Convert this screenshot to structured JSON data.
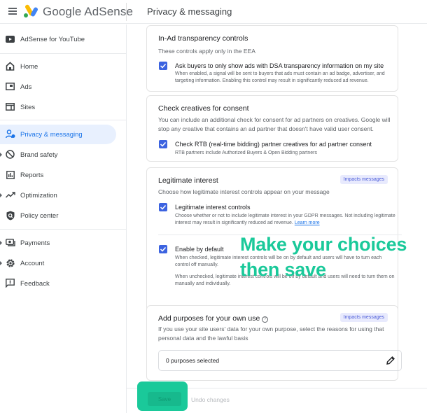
{
  "header": {
    "app_name": "Google AdSense",
    "page_title": "Privacy & messaging"
  },
  "sidebar": {
    "items": [
      {
        "label": "AdSense for YouTube",
        "icon": "youtube-icon"
      },
      {
        "label": "Home",
        "icon": "home-icon"
      },
      {
        "label": "Ads",
        "icon": "ads-icon"
      },
      {
        "label": "Sites",
        "icon": "sites-icon"
      },
      {
        "label": "Privacy & messaging",
        "icon": "privacy-icon",
        "active": true
      },
      {
        "label": "Brand safety",
        "icon": "block-icon",
        "expandable": true
      },
      {
        "label": "Reports",
        "icon": "reports-icon"
      },
      {
        "label": "Optimization",
        "icon": "trending-icon",
        "expandable": true
      },
      {
        "label": "Policy center",
        "icon": "policy-icon"
      },
      {
        "label": "Payments",
        "icon": "payments-icon",
        "expandable": true
      },
      {
        "label": "Account",
        "icon": "settings-icon",
        "expandable": true
      },
      {
        "label": "Feedback",
        "icon": "feedback-icon"
      }
    ]
  },
  "cards": {
    "transparency": {
      "title": "In-Ad transparency controls",
      "subtitle": "These controls apply only in the EEA",
      "option_title": "Ask buyers to only show ads with DSA transparency information on my site",
      "option_desc": "When enabled, a signal will be sent to buyers that ads must contain an ad badge, advertiser, and targeting information. Enabling this control may result in significantly reduced ad revenue.",
      "checked": true
    },
    "consent": {
      "title": "Check creatives for consent",
      "subtitle": "You can include an additional check for consent for ad partners on creatives. Google will stop any creative that contains an ad partner that doesn't have valid user consent.",
      "option_title": "Check RTB (real-time bidding) partner creatives for ad partner consent",
      "option_desc": "RTB partners include Authorized Buyers & Open Bidding partners",
      "checked": true
    },
    "legitimate": {
      "title": "Legitimate interest",
      "badge": "Impacts messages",
      "subtitle": "Choose how legitimate interest controls appear on your message",
      "option1_title": "Legitimate interest controls",
      "option1_desc": "Choose whether or not to include legitimate interest in your GDPR messages. Not including legitimate interest may result in significantly reduced ad revenue.",
      "option1_link": "Learn more",
      "option1_checked": true,
      "option2_title": "Enable by default",
      "option2_desc1": "When checked, legitimate interest controls will be on by default and users will have to turn each control off manually.",
      "option2_desc2": "When unchecked, legitimate interest controls will be off by default and users will need to turn them on manually and individually.",
      "option2_checked": true
    },
    "purposes": {
      "title": "Add purposes for your own use",
      "badge": "Impacts messages",
      "subtitle": "If you use your site users' data for your own purpose, select the reasons for using that personal data and the lawful basis",
      "field_value": "0 purposes selected"
    }
  },
  "footer": {
    "save_label": "Save",
    "undo_label": "Undo changes"
  },
  "annotation": {
    "line1": "Make your choices",
    "line2": "then save",
    "color": "#1ac99a"
  }
}
